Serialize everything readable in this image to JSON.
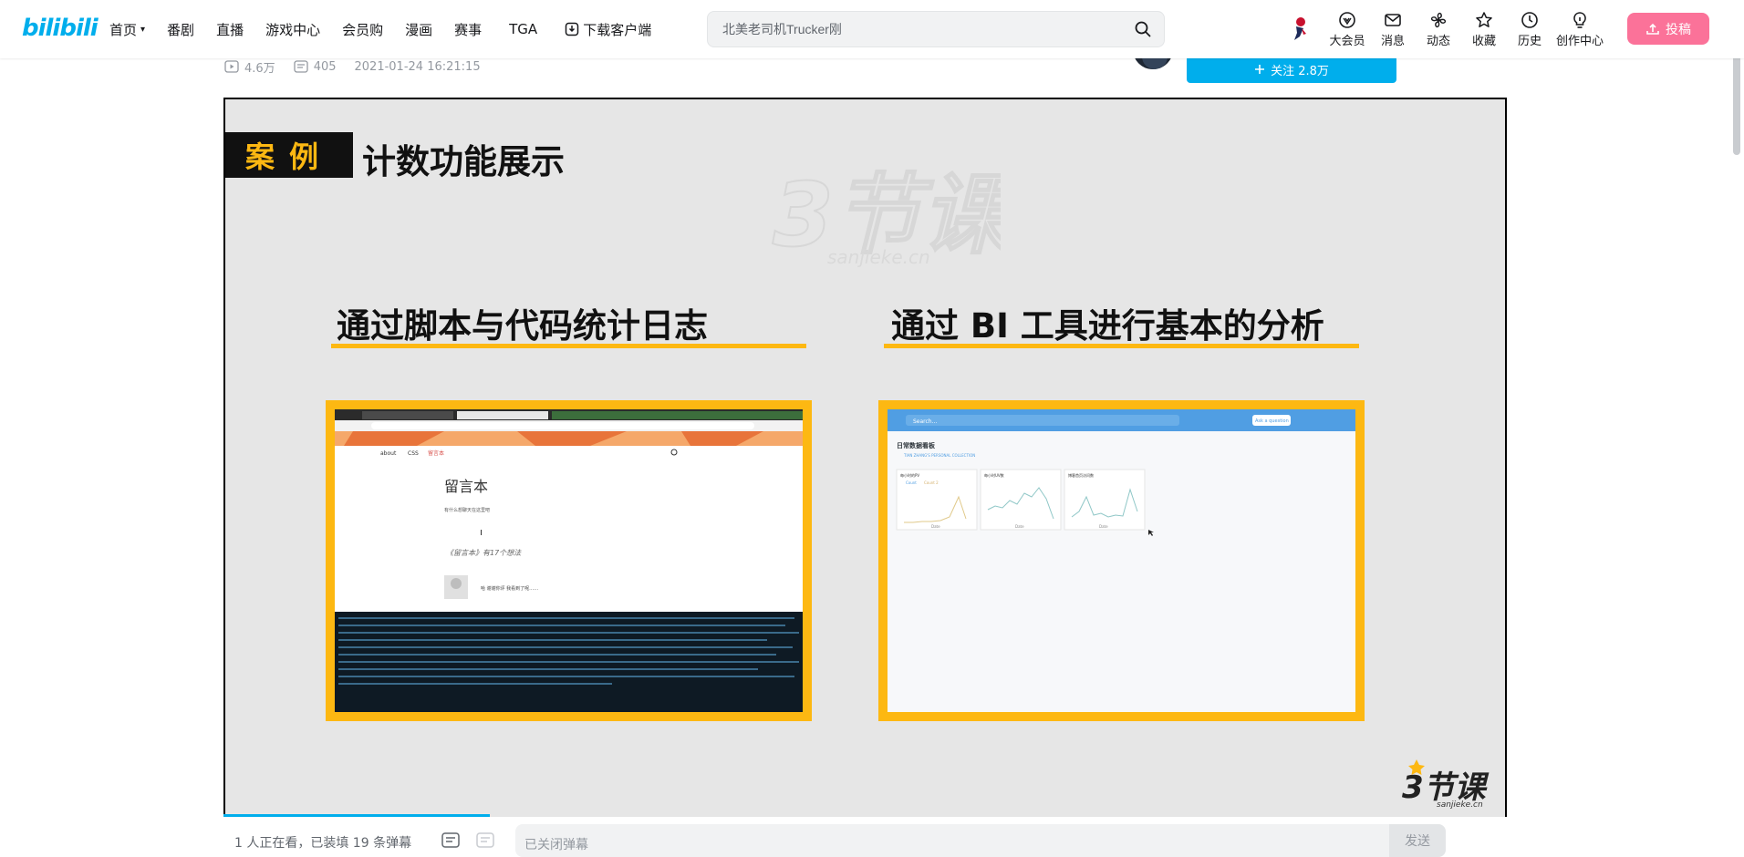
{
  "header": {
    "logo": "bilibili",
    "nav": [
      {
        "label": "首页",
        "has_dropdown": true
      },
      {
        "label": "番剧"
      },
      {
        "label": "直播"
      },
      {
        "label": "游戏中心"
      },
      {
        "label": "会员购"
      },
      {
        "label": "漫画"
      },
      {
        "label": "赛事"
      },
      {
        "label": "TGA"
      },
      {
        "label": "下载客户端",
        "icon": "download-icon"
      }
    ],
    "search": {
      "value": "北美老司机Trucker刚"
    },
    "right_items": [
      {
        "label": "大会员",
        "icon": "vip-icon"
      },
      {
        "label": "消息",
        "icon": "mail-icon"
      },
      {
        "label": "动态",
        "icon": "fan-icon"
      },
      {
        "label": "收藏",
        "icon": "star-icon"
      },
      {
        "label": "历史",
        "icon": "clock-icon"
      },
      {
        "label": "创作中心",
        "icon": "bulb-icon"
      }
    ],
    "upload_label": "投稿"
  },
  "video": {
    "views": "4.6万",
    "danmaku_count": "405",
    "date": "2021-01-24 16:21:15",
    "follow_label": "关注 2.8万"
  },
  "slide": {
    "badge": "案例",
    "title": "计数功能展示",
    "heading_left": "通过脚本与代码统计日志",
    "heading_right": "通过 BI 工具进行基本的分析",
    "left_shot": {
      "nav_links": [
        "about",
        "CSS",
        "留言本"
      ],
      "page_title": "留言本",
      "subtitle": "有什么想聊天在这里吧",
      "count_line": "《留言本》有17个想法",
      "comment": "哈 谢谢你评 我看到了呢……"
    },
    "right_shot": {
      "search_placeholder": "Search…",
      "ask_button": "Ask a question",
      "dashboard_title": "日常数据看板",
      "collection": "TIAN ZHANG'S PERSONAL COLLECTION",
      "chart_titles": [
        "每小时的PV",
        "每小时UV数",
        "博客首页访问数"
      ],
      "legend": [
        "Count",
        "Count 2"
      ],
      "axis_label": "Date"
    },
    "corner_logo": "3节课",
    "corner_logo_sub": "sanjieke.cn",
    "watermark": "3节课",
    "watermark_sub": "sanjieke.cn"
  },
  "bottom_bar": {
    "viewers": "1 人正在看，已装填 19 条弹幕",
    "input_placeholder": "已关闭弹幕",
    "send_label": "发送"
  },
  "colors": {
    "accent": "#00aeec",
    "upload": "#fb7299",
    "highlight": "#fdb812"
  }
}
